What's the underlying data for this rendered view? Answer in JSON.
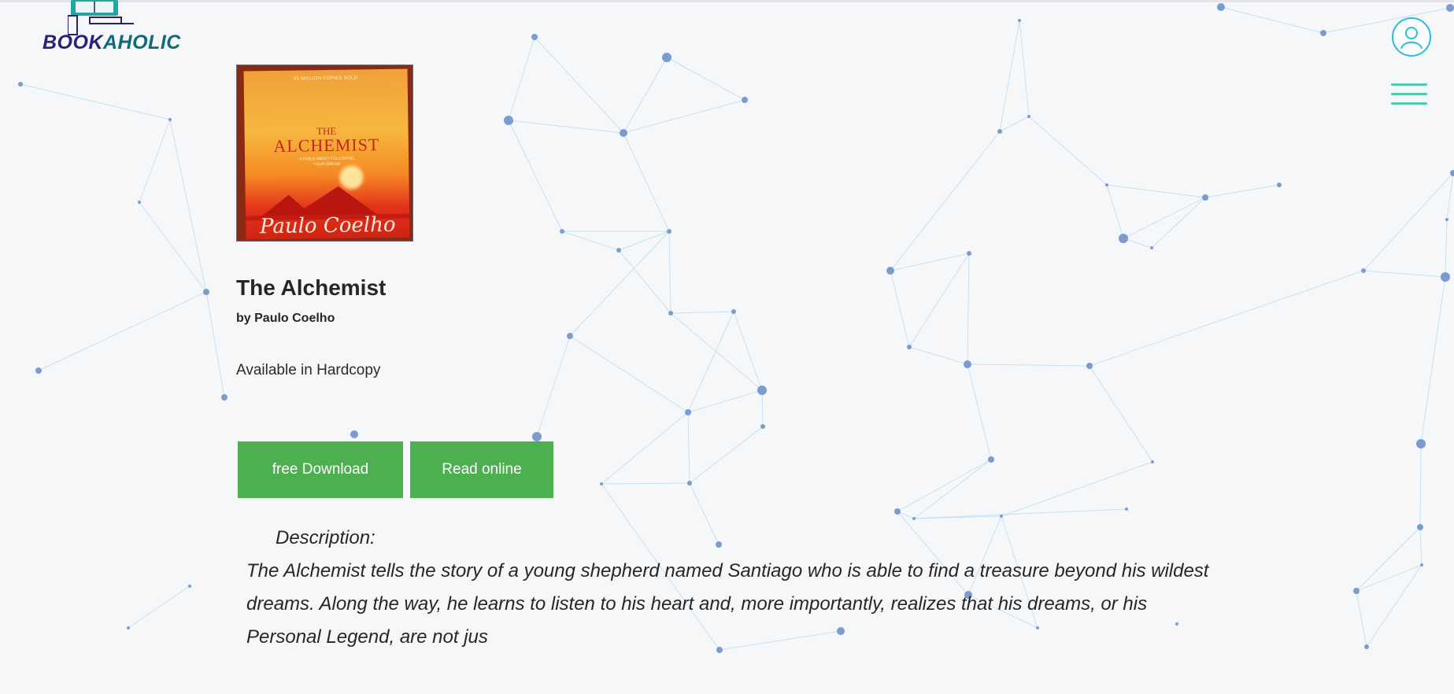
{
  "header": {
    "logo_text_1": "BOOK",
    "logo_text_2": "AHOLIC",
    "logo_icon": "book-laptop-icon",
    "user_icon": "user-icon",
    "menu_icon": "hamburger-menu-icon"
  },
  "book": {
    "cover": {
      "top_line": "65 MILLION COPIES SOLD",
      "the": "THE",
      "title": "ALCHEMIST",
      "subtitle_1": "A FABLE ABOUT FOLLOWING",
      "subtitle_2": "YOUR DREAM",
      "author": "Paulo Coelho"
    },
    "title": "The Alchemist",
    "author": "by Paulo Coelho",
    "availability": "Available in Hardcopy",
    "free_download_label": "free Download",
    "read_online_label": "Read online",
    "description_label": "Description:",
    "description": "The Alchemist tells the story of a young shepherd named Santiago who is able to find a treasure beyond his wildest dreams. Along the way, he learns to listen to his heart and, more importantly, realizes that his dreams, or his Personal Legend, are not jus"
  },
  "colors": {
    "background": "#f6f7f8",
    "button": "#4caf50",
    "network_dot": "#7b9cce",
    "network_line": "#b9dcf2",
    "logo_dark": "#2a2176",
    "logo_teal": "#0f6a7a",
    "user_ring": "#25bde0",
    "menu": "#4ecbb0"
  }
}
